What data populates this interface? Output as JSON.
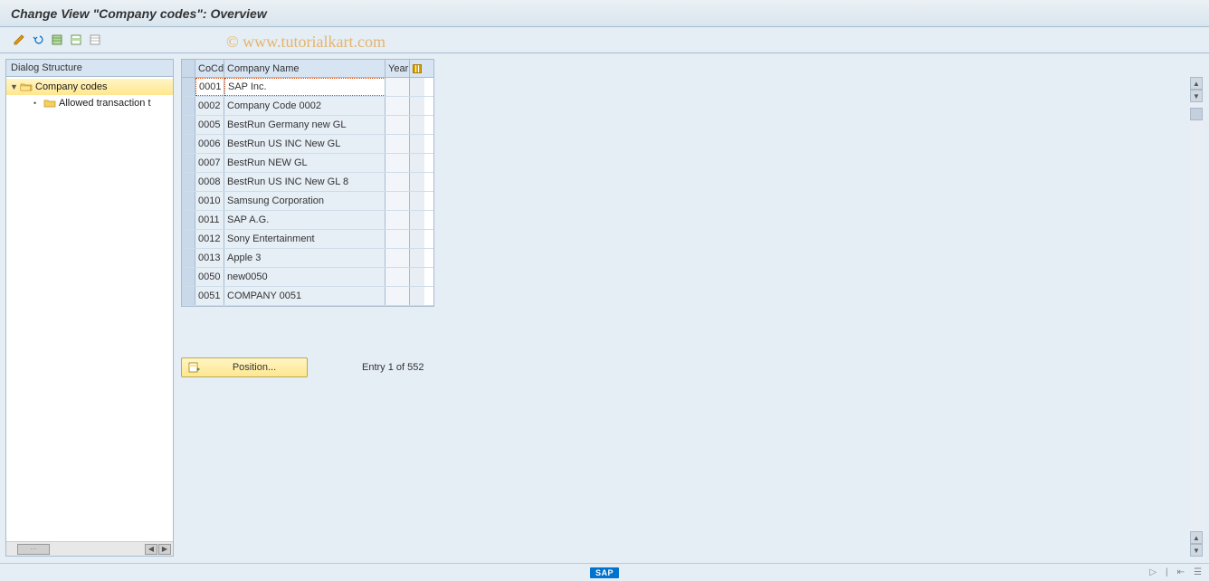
{
  "title": "Change View \"Company codes\": Overview",
  "watermark": "© www.tutorialkart.com",
  "toolbar_icons": [
    "display-change-icon",
    "undo-icon",
    "select-all-icon",
    "select-block-icon",
    "deselect-all-icon"
  ],
  "dialog": {
    "header": "Dialog Structure",
    "tree": [
      {
        "label": "Company codes",
        "expanded": true,
        "selected": true,
        "icon": "folder-open"
      },
      {
        "label": "Allowed transaction t",
        "child": true,
        "icon": "folder-closed"
      }
    ]
  },
  "table": {
    "headers": {
      "sel": "",
      "cocd": "CoCd",
      "name": "Company Name",
      "year": "Year"
    },
    "rows": [
      {
        "cocd": "0001",
        "name": "SAP Inc.",
        "year": "",
        "active": true
      },
      {
        "cocd": "0002",
        "name": "Company Code 0002",
        "year": ""
      },
      {
        "cocd": "0005",
        "name": "BestRun Germany new GL",
        "year": ""
      },
      {
        "cocd": "0006",
        "name": "BestRun US INC New GL",
        "year": ""
      },
      {
        "cocd": "0007",
        "name": "BestRun NEW GL",
        "year": ""
      },
      {
        "cocd": "0008",
        "name": "BestRun US INC New GL 8",
        "year": ""
      },
      {
        "cocd": "0010",
        "name": "Samsung Corporation",
        "year": ""
      },
      {
        "cocd": "0011",
        "name": "SAP A.G.",
        "year": ""
      },
      {
        "cocd": "0012",
        "name": "Sony Entertainment",
        "year": ""
      },
      {
        "cocd": "0013",
        "name": "Apple 3",
        "year": ""
      },
      {
        "cocd": "0050",
        "name": "new0050",
        "year": ""
      },
      {
        "cocd": "0051",
        "name": "COMPANY 0051",
        "year": ""
      }
    ]
  },
  "position_button": "Position...",
  "entry_text": "Entry 1 of 552",
  "sap_logo_text": "SAP"
}
